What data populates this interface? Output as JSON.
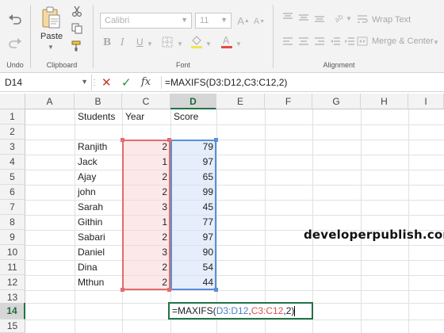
{
  "ribbon": {
    "undo_group_label": "Undo",
    "clipboard_group_label": "Clipboard",
    "paste_label": "Paste",
    "font_group_label": "Font",
    "font_name": "Calibri",
    "font_size": "11",
    "alignment_group_label": "Alignment",
    "wrap_text_label": "Wrap Text",
    "merge_center_label": "Merge & Center",
    "colors": {
      "highlight": "#f2e35c",
      "font_color": "#e74c3c"
    }
  },
  "formula_bar": {
    "name_box": "D14",
    "formula": "=MAXIFS(D3:D12,C3:C12,2)"
  },
  "grid": {
    "columns": [
      "A",
      "B",
      "C",
      "D",
      "E",
      "F",
      "G",
      "H",
      "I"
    ],
    "active_column": "D",
    "rows": [
      "1",
      "2",
      "3",
      "4",
      "5",
      "6",
      "7",
      "8",
      "9",
      "10",
      "11",
      "12",
      "13",
      "14",
      "15"
    ],
    "active_row": "14",
    "headers": {
      "b": "Students",
      "c": "Year",
      "d": "Score"
    },
    "data": [
      {
        "student": "Ranjith",
        "year": "2",
        "score": "79"
      },
      {
        "student": "Jack",
        "year": "1",
        "score": "97"
      },
      {
        "student": "Ajay",
        "year": "2",
        "score": "65"
      },
      {
        "student": "john",
        "year": "2",
        "score": "99"
      },
      {
        "student": "Sarah",
        "year": "3",
        "score": "45"
      },
      {
        "student": "Githin",
        "year": "1",
        "score": "77"
      },
      {
        "student": "Sabari",
        "year": "2",
        "score": "97"
      },
      {
        "student": "Daniel",
        "year": "3",
        "score": "90"
      },
      {
        "student": "Dina",
        "year": "2",
        "score": "54"
      },
      {
        "student": "Mthun",
        "year": "2",
        "score": "44"
      }
    ],
    "edit_cell": {
      "prefix": "=MAXIFS(",
      "ref1": "D3:D12",
      "comma1": ",",
      "ref2": "C3:C12",
      "suffix": ",2)"
    },
    "range_colors": {
      "criteria_range": "#e36c6c",
      "max_range": "#5b8fd6"
    }
  },
  "watermark": "developerpublish.com"
}
